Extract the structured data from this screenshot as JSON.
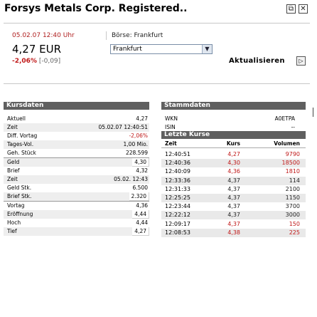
{
  "window": {
    "title": "Forsys Metals Corp. Registered..",
    "btn1": "⧉",
    "btn2": "✕"
  },
  "quote": {
    "datetime": "05.02.07  12:40 Uhr",
    "boerse": "Börse: Frankfurt",
    "price": "4,27 EUR",
    "exchange_selected": "Frankfurt",
    "change_pct": "-2,06%",
    "change_abs": "[-0,09]",
    "refresh_label": "Aktualisieren",
    "refresh_icon": "▷"
  },
  "kursdaten": {
    "header": "Kursdaten",
    "rows": [
      {
        "label": "Aktuell",
        "value": "4,27"
      },
      {
        "label": "Zeit",
        "value": "05.02.07 12:40:51"
      },
      {
        "label": "Diff. Vortag",
        "value": "-2,06%"
      },
      {
        "label": "Tages-Vol.",
        "value": "1,00 Mio."
      },
      {
        "label": "Geh. Stück",
        "value": "228.599"
      },
      {
        "label": "Geld",
        "value": "4,30"
      },
      {
        "label": "Brief",
        "value": "4,32"
      },
      {
        "label": "Zeit",
        "value": "05.02. 12:43"
      },
      {
        "label": "Geld Stk.",
        "value": "6.500"
      },
      {
        "label": "Brief Stk.",
        "value": "2.320"
      },
      {
        "label": "Vortag",
        "value": "4,36"
      },
      {
        "label": "Eröffnung",
        "value": "4,44"
      },
      {
        "label": "Hoch",
        "value": "4,44"
      },
      {
        "label": "Tief",
        "value": "4,27"
      }
    ]
  },
  "stammdaten": {
    "header": "Stammdaten",
    "rows": [
      {
        "label": "WKN",
        "value": "A0ETPA"
      },
      {
        "label": "ISIN",
        "value": "--"
      }
    ]
  },
  "letzte_kurse": {
    "header": "Letzte Kurse",
    "columns": [
      "Zeit",
      "Kurs",
      "Volumen"
    ],
    "rows": [
      {
        "zeit": "12:40:51",
        "kurs": "4,27",
        "vol": "9790",
        "color": "red"
      },
      {
        "zeit": "12:40:36",
        "kurs": "4,30",
        "vol": "18500",
        "color": "red"
      },
      {
        "zeit": "12:40:09",
        "kurs": "4,36",
        "vol": "1810",
        "color": "red"
      },
      {
        "zeit": "12:33:36",
        "kurs": "4,37",
        "vol": "114",
        "color": "dark"
      },
      {
        "zeit": "12:31:33",
        "kurs": "4,37",
        "vol": "2100",
        "color": "dark"
      },
      {
        "zeit": "12:25:25",
        "kurs": "4,37",
        "vol": "1150",
        "color": "dark"
      },
      {
        "zeit": "12:23:44",
        "kurs": "4,37",
        "vol": "3700",
        "color": "dark"
      },
      {
        "zeit": "12:22:12",
        "kurs": "4,37",
        "vol": "3000",
        "color": "dark"
      },
      {
        "zeit": "12:09:17",
        "kurs": "4,37",
        "vol": "150",
        "color": "red"
      },
      {
        "zeit": "12:08:53",
        "kurs": "4,38",
        "vol": "225",
        "color": "red"
      }
    ]
  }
}
